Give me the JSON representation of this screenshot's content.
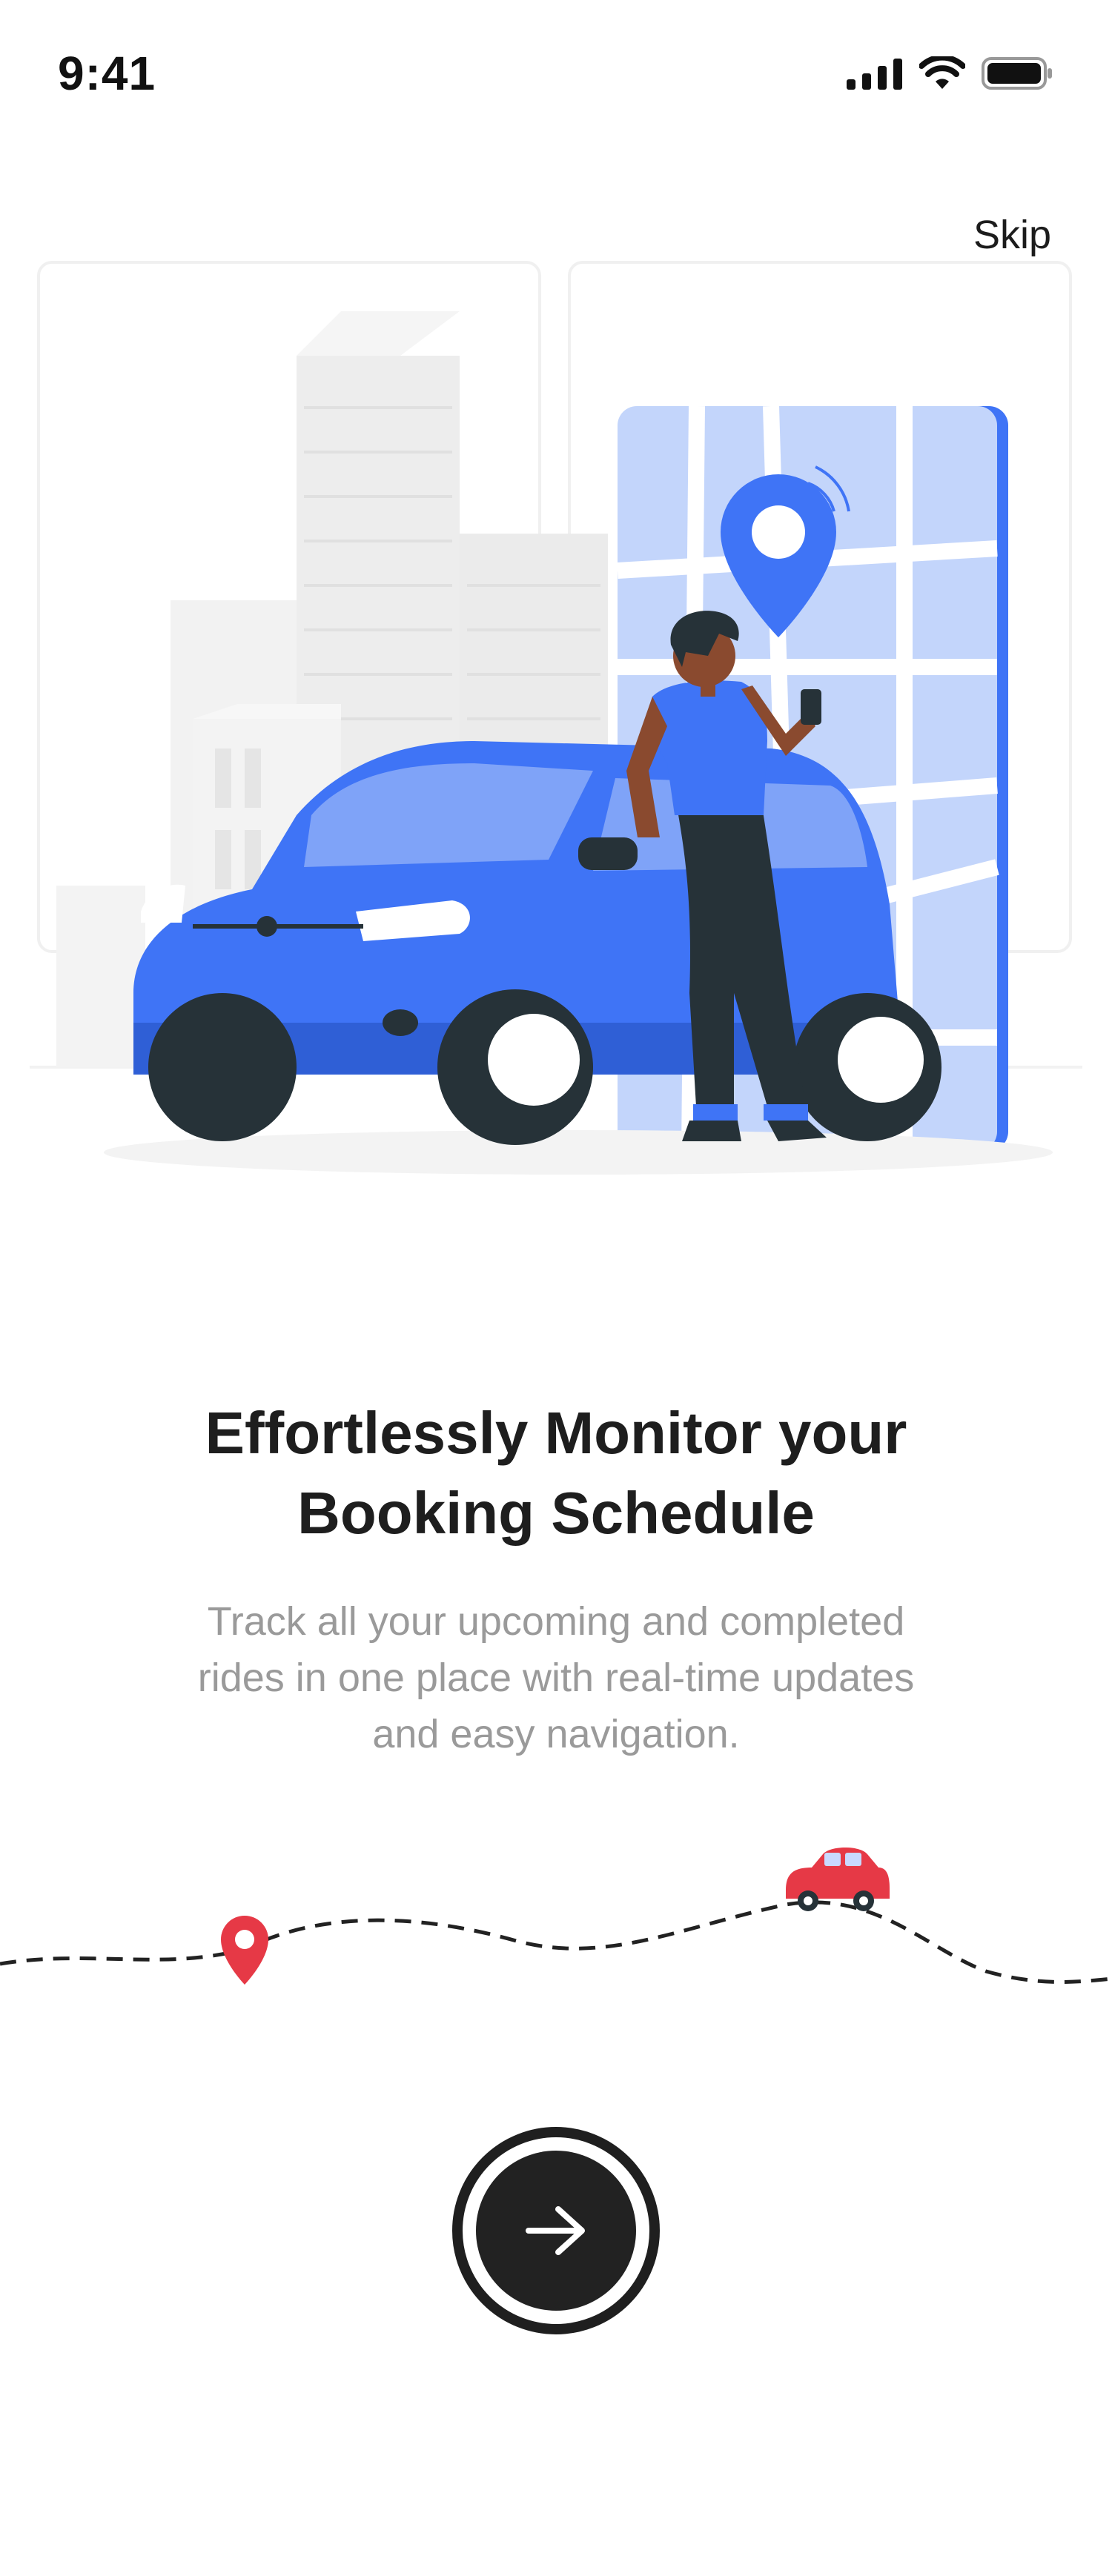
{
  "status_bar": {
    "time": "9:41"
  },
  "header": {
    "skip_label": "Skip"
  },
  "onboarding": {
    "title_line1": "Effortlessly Monitor your",
    "title_line2": "Booking Schedule",
    "subtitle": "Track all your upcoming and completed rides in one place with real-time updates and easy navigation."
  },
  "icons": {
    "signal": "cellular-signal-icon",
    "wifi": "wifi-icon",
    "battery": "battery-icon",
    "next": "arrow-right-icon",
    "pin": "location-pin-icon",
    "car": "car-icon"
  },
  "colors": {
    "accent_blue": "#3f74f6",
    "pin_red": "#e63946",
    "dark": "#222222"
  }
}
